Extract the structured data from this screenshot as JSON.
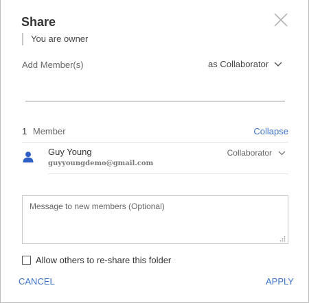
{
  "dialog": {
    "title": "Share",
    "owner_note": "You are owner",
    "add_members_label": "Add Member(s)",
    "role_select_value": "as Collaborator",
    "member_input_value": ""
  },
  "members": {
    "count": "1",
    "label": "Member",
    "collapse_label": "Collapse",
    "list": [
      {
        "name": "Guy Young",
        "email": "guyyoungdemo@gmail.com",
        "role": "Collaborator",
        "icon": "person-icon"
      }
    ]
  },
  "message": {
    "placeholder": "Message to new members (Optional)",
    "value": ""
  },
  "reshare": {
    "label": "Allow others to re-share this folder",
    "checked": false
  },
  "actions": {
    "cancel_label": "CANCEL",
    "apply_label": "APPLY"
  },
  "colors": {
    "accent": "#3d72c9",
    "avatar": "#2f5fc4"
  }
}
